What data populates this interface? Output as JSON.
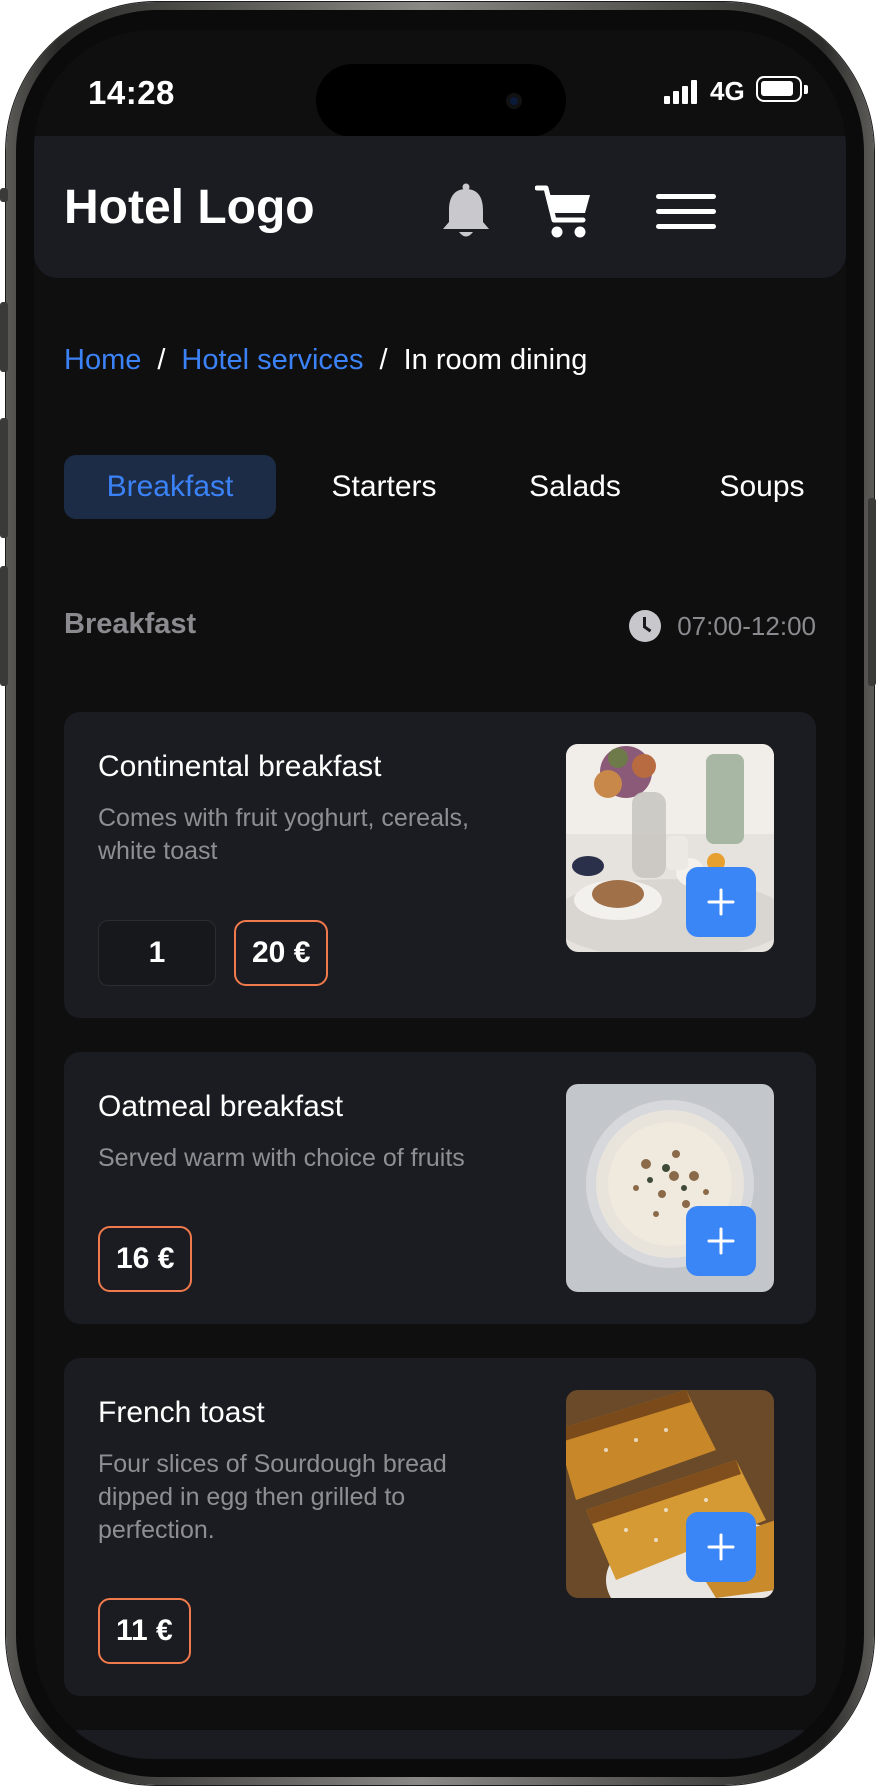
{
  "status_bar": {
    "time": "14:28",
    "network": "4G"
  },
  "header": {
    "logo": "Hotel Logo",
    "icons": [
      "bell-icon",
      "cart-icon",
      "menu-icon"
    ]
  },
  "breadcrumb": {
    "home": "Home",
    "services": "Hotel services",
    "current": "In room dining",
    "separator": "/"
  },
  "tabs": [
    {
      "label": "Breakfast",
      "active": true
    },
    {
      "label": "Starters",
      "active": false
    },
    {
      "label": "Salads",
      "active": false
    },
    {
      "label": "Soups",
      "active": false
    }
  ],
  "section": {
    "title": "Breakfast",
    "hours": "07:00-12:00"
  },
  "items": [
    {
      "name": "Continental breakfast",
      "description": "Comes with fruit yoghurt, cereals, white toast",
      "quantity": "1",
      "price": "20 €",
      "image": "continental-breakfast-photo"
    },
    {
      "name": "Oatmeal breakfast",
      "description": "Served warm with choice of fruits",
      "price": "16 €",
      "image": "oatmeal-bowl-photo"
    },
    {
      "name": "French toast",
      "description": "Four slices of Sourdough bread dipped in egg then grilled to perfection.",
      "price": "11 €",
      "image": "french-toast-photo"
    }
  ],
  "colors": {
    "accent": "#3b82f6",
    "price_border": "#f07a4c",
    "card_bg": "#1b1c21",
    "screen_bg": "#0f0f10"
  }
}
